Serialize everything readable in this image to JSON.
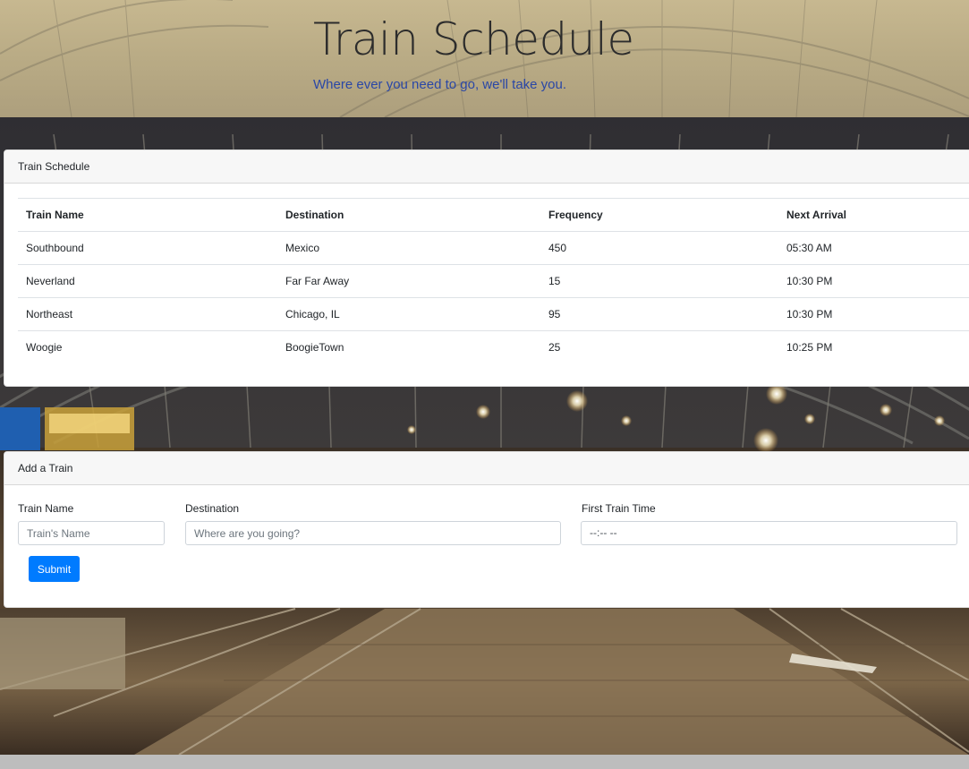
{
  "header": {
    "title": "Train Schedule",
    "tagline": "Where ever you need to go, we'll take you."
  },
  "schedule": {
    "card_title": "Train Schedule",
    "columns": [
      "Train Name",
      "Destination",
      "Frequency",
      "Next Arrival"
    ],
    "rows": [
      [
        "Southbound",
        "Mexico",
        "450",
        "05:30 AM"
      ],
      [
        "Neverland",
        "Far Far Away",
        "15",
        "10:30 PM"
      ],
      [
        "Northeast",
        "Chicago, IL",
        "95",
        "10:30 PM"
      ],
      [
        "Woogie",
        "BoogieTown",
        "25",
        "10:25 PM"
      ]
    ]
  },
  "add_form": {
    "card_title": "Add a Train",
    "train_name": {
      "label": "Train Name",
      "placeholder": "Train's Name",
      "value": ""
    },
    "destination": {
      "label": "Destination",
      "placeholder": "Where are you going?",
      "value": ""
    },
    "first_time": {
      "label": "First Train Time",
      "display": "--:-- --"
    },
    "submit_label": "Submit"
  },
  "colors": {
    "primary_button": "#007bff",
    "tagline": "#2a47a6",
    "header_bg": "#b9ab85"
  }
}
